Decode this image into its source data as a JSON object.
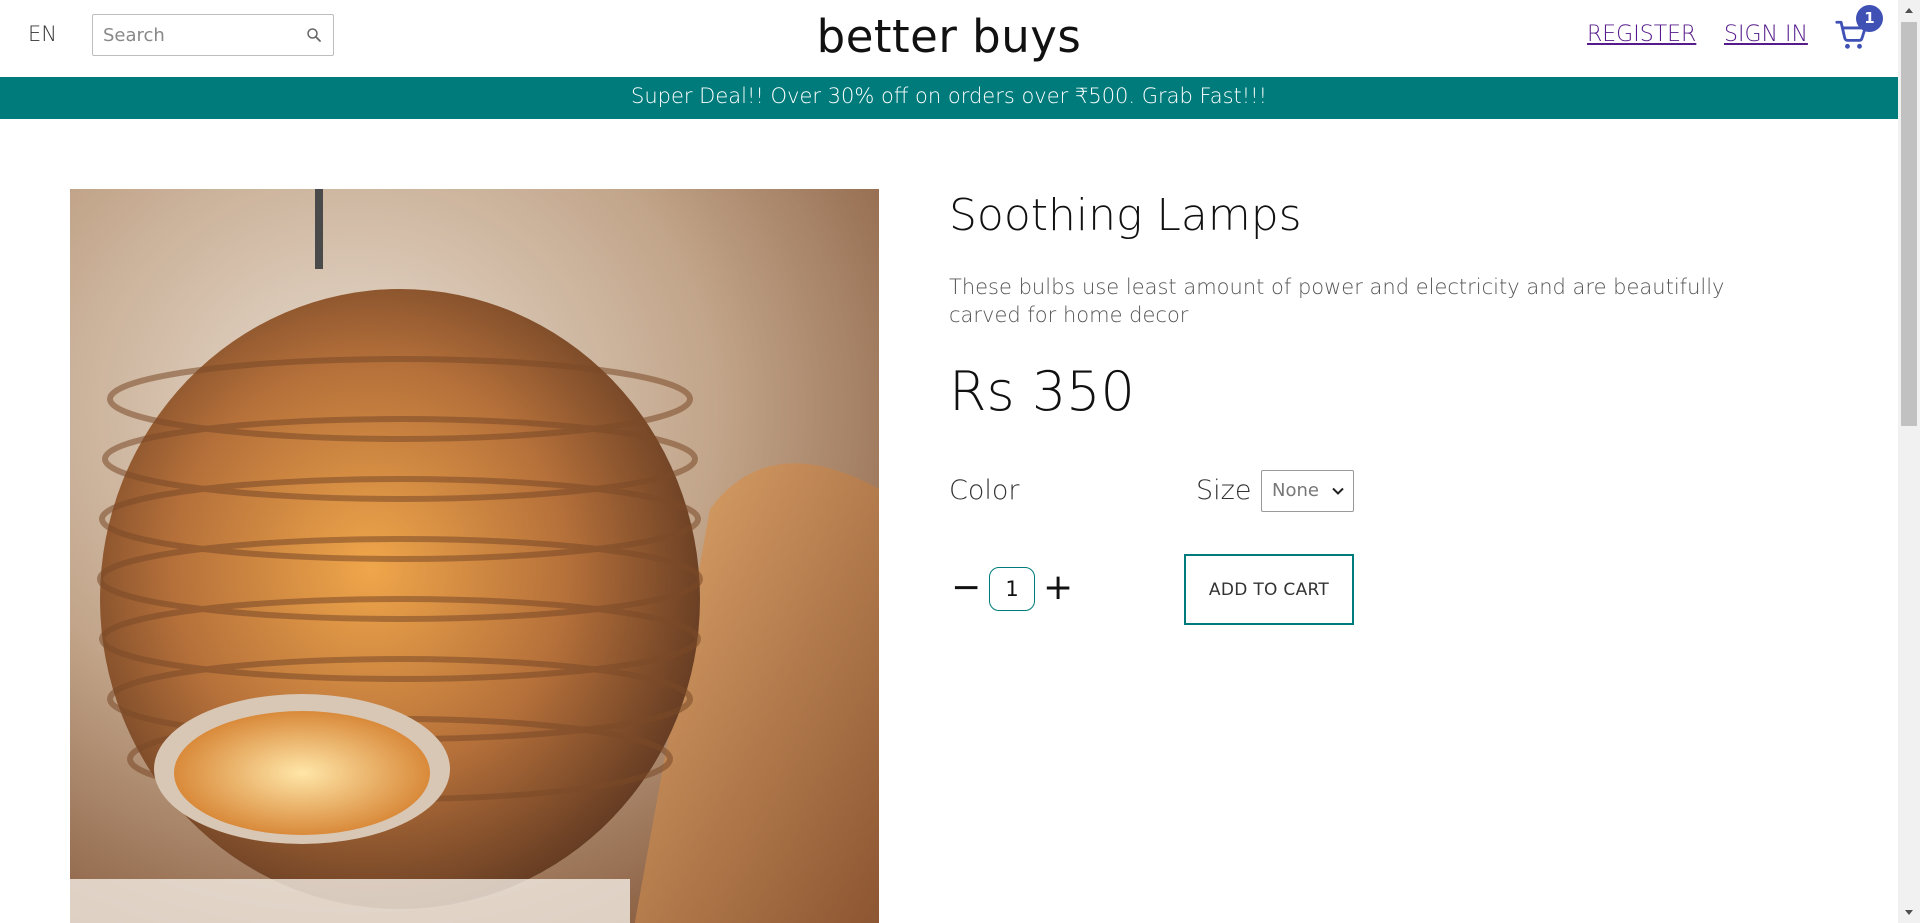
{
  "header": {
    "language": "EN",
    "search_placeholder": "Search",
    "brand": "better buys",
    "register": "REGISTER",
    "sign_in": "SIGN IN",
    "cart_count": "1"
  },
  "banner": {
    "text": "Super Deal!! Over 30% off on orders over ₹500. Grab Fast!!!"
  },
  "product": {
    "title": "Soothing Lamps",
    "description": "These bulbs use least amount of power and electricity and are beautifully carved for home decor",
    "price": "Rs 350",
    "color_label": "Color",
    "size_label": "Size",
    "size_selected": "None",
    "quantity": "1",
    "minus": "−",
    "plus": "+",
    "add_to_cart": "ADD TO CART"
  },
  "colors": {
    "accent": "#007b7b",
    "badge": "#3f51b5",
    "link": "#551a8b"
  },
  "icons": {
    "search": "search-icon",
    "cart": "cart-icon",
    "chevron": "chevron-down-icon"
  }
}
